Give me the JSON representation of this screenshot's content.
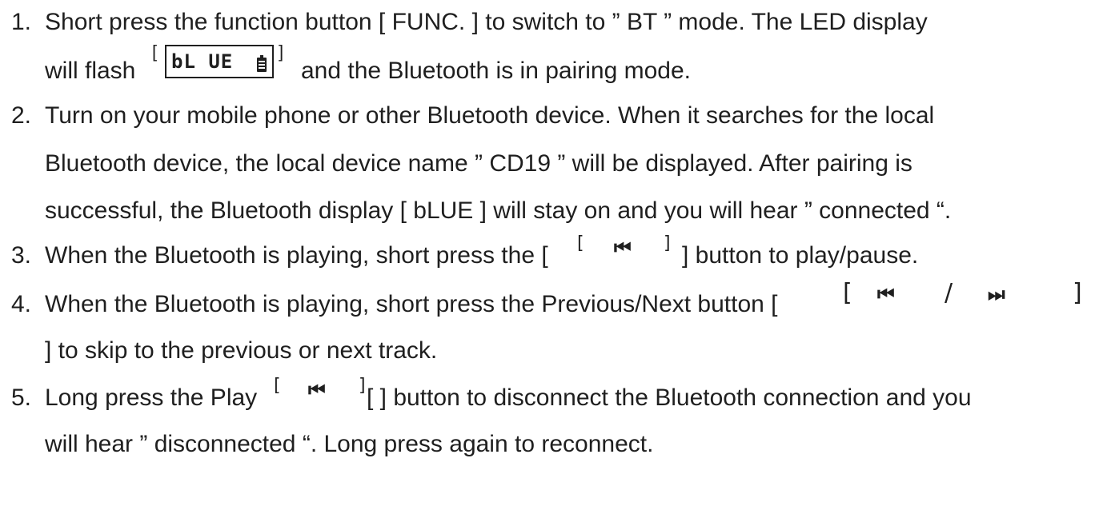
{
  "steps": [
    {
      "number": "1.",
      "line1": "Short press the function button [ FUNC. ] to switch to ” BT ” mode. The LED display",
      "line2_before": "will flash",
      "line2_after": "and the Bluetooth is in pairing mode.",
      "display_graphic": {
        "open_bracket": "[",
        "lcd_text": "bL UE",
        "icon": "battery-icon",
        "close_bracket": "]"
      }
    },
    {
      "number": "2.",
      "line1": "Turn on your mobile phone or other Bluetooth device. When it searches for the local",
      "line2": "Bluetooth device, the local device name ” CD19 ” will be displayed. After pairing is",
      "line3": "successful, the Bluetooth display [ bLUE ] will stay on and you will hear ” connected “."
    },
    {
      "number": "3.",
      "before": "When the Bluetooth is playing, short press the [",
      "button_graphic": {
        "open_bracket": "[",
        "symbol": "⏮",
        "close_bracket": "]"
      },
      "after": "] button to play/pause."
    },
    {
      "number": "4.",
      "before": "When the Bluetooth is playing, short press the Previous/Next button [",
      "button_graphic": {
        "open_bracket": "[",
        "prev_symbol": "⏮",
        "separator": "/",
        "next_symbol": "⏭",
        "close_bracket": "]"
      },
      "line2": "] to skip to the previous or next track."
    },
    {
      "number": "5.",
      "before": "Long press the Play",
      "button_graphic": {
        "open_bracket": "[",
        "symbol": "⏮",
        "close_bracket": "]"
      },
      "after": "[ ] button to disconnect the Bluetooth connection and you",
      "line2": "will hear ” disconnected “. Long press again to reconnect."
    }
  ]
}
